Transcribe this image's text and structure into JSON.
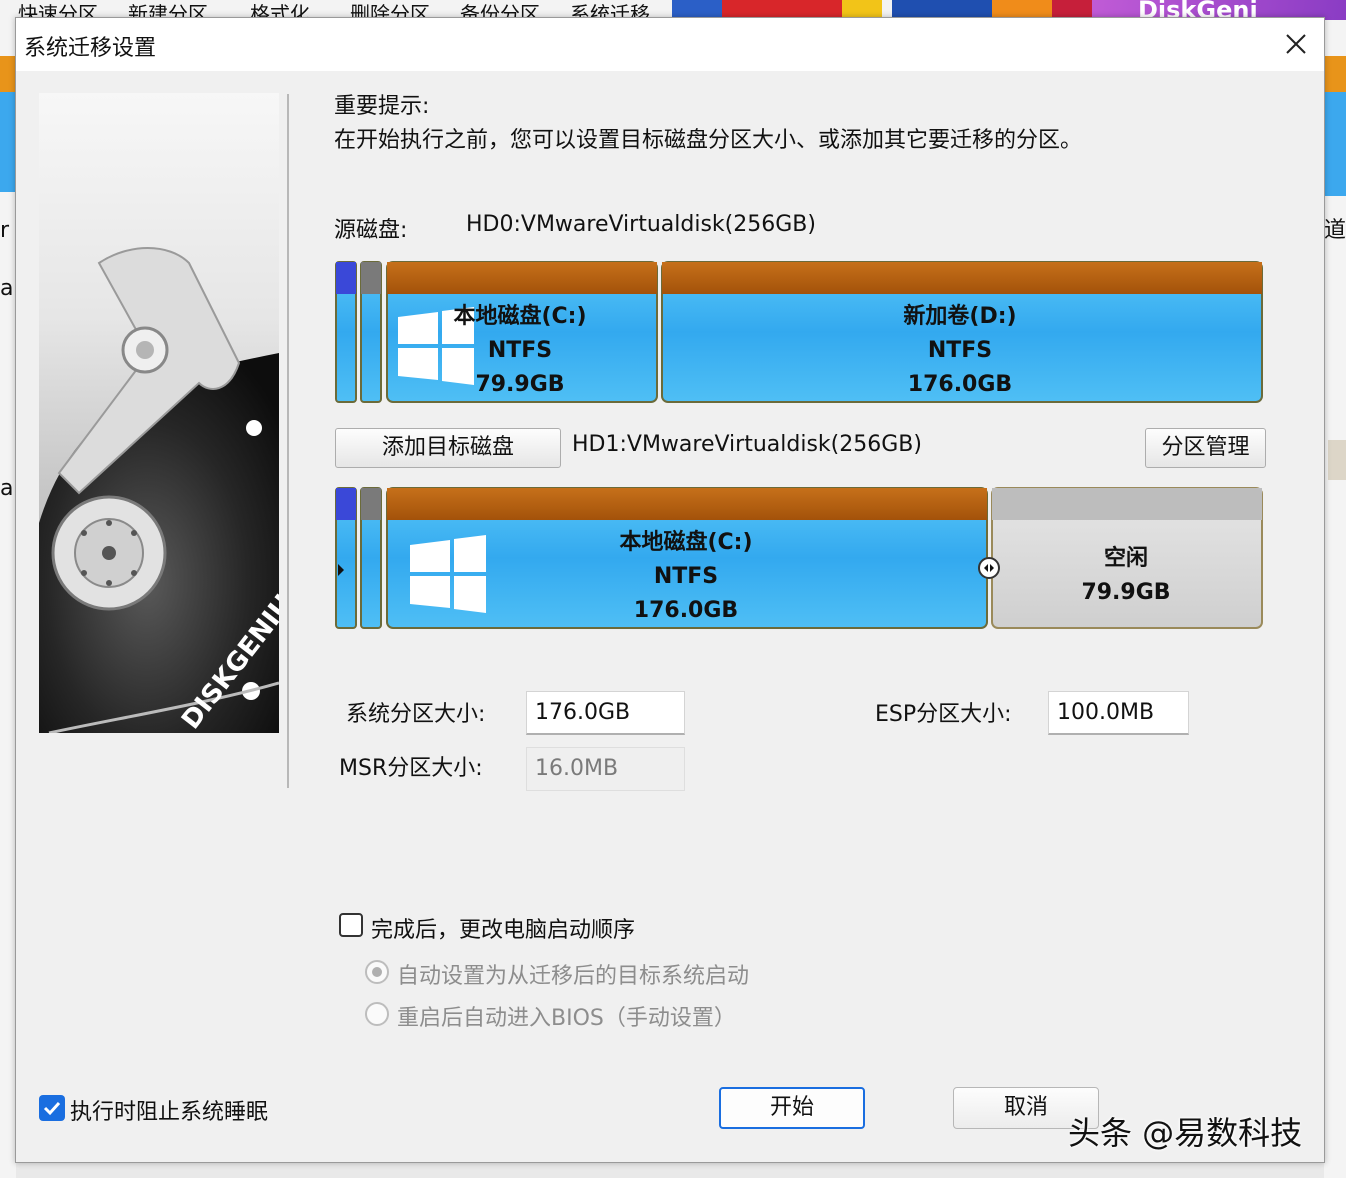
{
  "background_app": {
    "menu_items": [
      "快速分区",
      "新建分区",
      "格式化",
      "删除分区",
      "备份分区",
      "系统迁移"
    ],
    "banner_text": "DiskGeni",
    "edge_chars_left": [
      "r",
      "a",
      "a"
    ],
    "edge_char_right": "道"
  },
  "dialog": {
    "title": "系统迁移设置",
    "close_glyph": "✕",
    "brand_text": "DISKGENIUS"
  },
  "hint": {
    "title": "重要提示:",
    "text": "在开始执行之前，您可以设置目标磁盘分区大小、或添加其它要迁移的分区。"
  },
  "source": {
    "label": "源磁盘:",
    "disk": "HD0:VMwareVirtualdisk(256GB)",
    "partitions": [
      {
        "name": "本地磁盘(C:)",
        "fs": "NTFS",
        "size": "79.9GB",
        "has_windows_logo": true
      },
      {
        "name": "新加卷(D:)",
        "fs": "NTFS",
        "size": "176.0GB",
        "has_windows_logo": false
      }
    ]
  },
  "target": {
    "add_button": "添加目标磁盘",
    "disk": "HD1:VMwareVirtualdisk(256GB)",
    "manage_button": "分区管理",
    "partitions": [
      {
        "name": "本地磁盘(C:)",
        "fs": "NTFS",
        "size": "176.0GB",
        "has_windows_logo": true
      },
      {
        "name": "空闲",
        "size": "79.9GB"
      }
    ]
  },
  "fields": {
    "sys_label": "系统分区大小:",
    "sys_value": "176.0GB",
    "esp_label": "ESP分区大小:",
    "esp_value": "100.0MB",
    "msr_label": "MSR分区大小:",
    "msr_value": "16.0MB"
  },
  "options": {
    "change_boot_label": "完成后，更改电脑启动顺序",
    "change_boot_checked": false,
    "radio_auto": "自动设置为从迁移后的目标系统启动",
    "radio_bios": "重启后自动进入BIOS（手动设置）",
    "prevent_sleep_label": "执行时阻止系统睡眠",
    "prevent_sleep_checked": true
  },
  "buttons": {
    "start": "开始",
    "cancel": "取消"
  },
  "watermark": "头条 @易数科技",
  "colors": {
    "accent": "#1a6ee0",
    "partition_header": "#b85e0a",
    "partition_blue": "#3fb3f2",
    "free_gray": "#d4d4d4"
  }
}
